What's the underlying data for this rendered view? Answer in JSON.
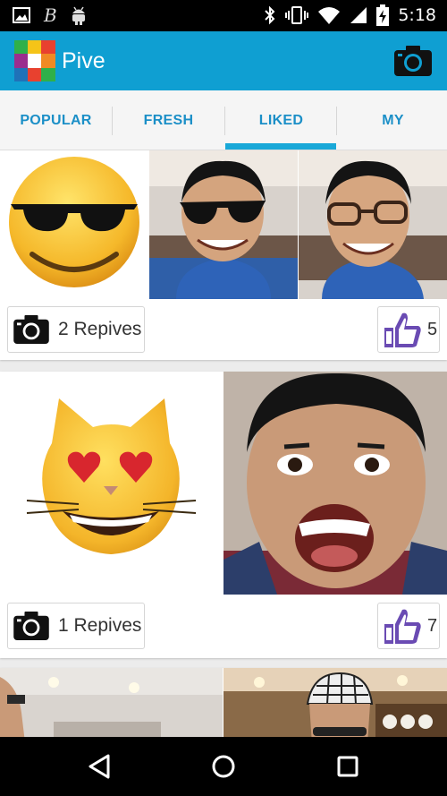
{
  "status_bar": {
    "time": "5:18",
    "left_icons": [
      "image-icon",
      "bitcoin-icon",
      "android-icon"
    ],
    "right_icons": [
      "bluetooth-icon",
      "vibrate-icon",
      "wifi-icon",
      "signal-icon",
      "battery-charging-icon"
    ]
  },
  "app_bar": {
    "title": "Pive",
    "logo_colors": [
      "#2fb04a",
      "#f5c418",
      "#e8412f",
      "#9b2d8e",
      "#ffffff",
      "#1f72b8",
      "#f08a24"
    ],
    "action_icon": "camera-icon"
  },
  "tabs": {
    "items": [
      {
        "label": "POPULAR"
      },
      {
        "label": "FRESH"
      },
      {
        "label": "LIKED"
      },
      {
        "label": "MY"
      }
    ],
    "selected": "LIKED"
  },
  "feed": {
    "posts": [
      {
        "photos": [
          "emoji-sunglasses",
          "selfie-with-sunglasses",
          "selfie-with-glasses"
        ],
        "repives_label": "2 Repives",
        "likes": "5"
      },
      {
        "photos": [
          "emoji-heart-eyes-cat",
          "selfie-surprised-face"
        ],
        "repives_label": "1 Repives",
        "likes": "7"
      },
      {
        "photos": [
          "photo-person-waving",
          "photo-person-with-hat"
        ]
      }
    ]
  },
  "nav_bar": {
    "buttons": [
      "back-icon",
      "home-icon",
      "recents-icon"
    ]
  },
  "colors": {
    "app_bar": "#0f9fd2",
    "tab_text": "#1b8fc7",
    "tab_indicator": "#19a8d8",
    "like_icon": "#6a4bb3"
  }
}
